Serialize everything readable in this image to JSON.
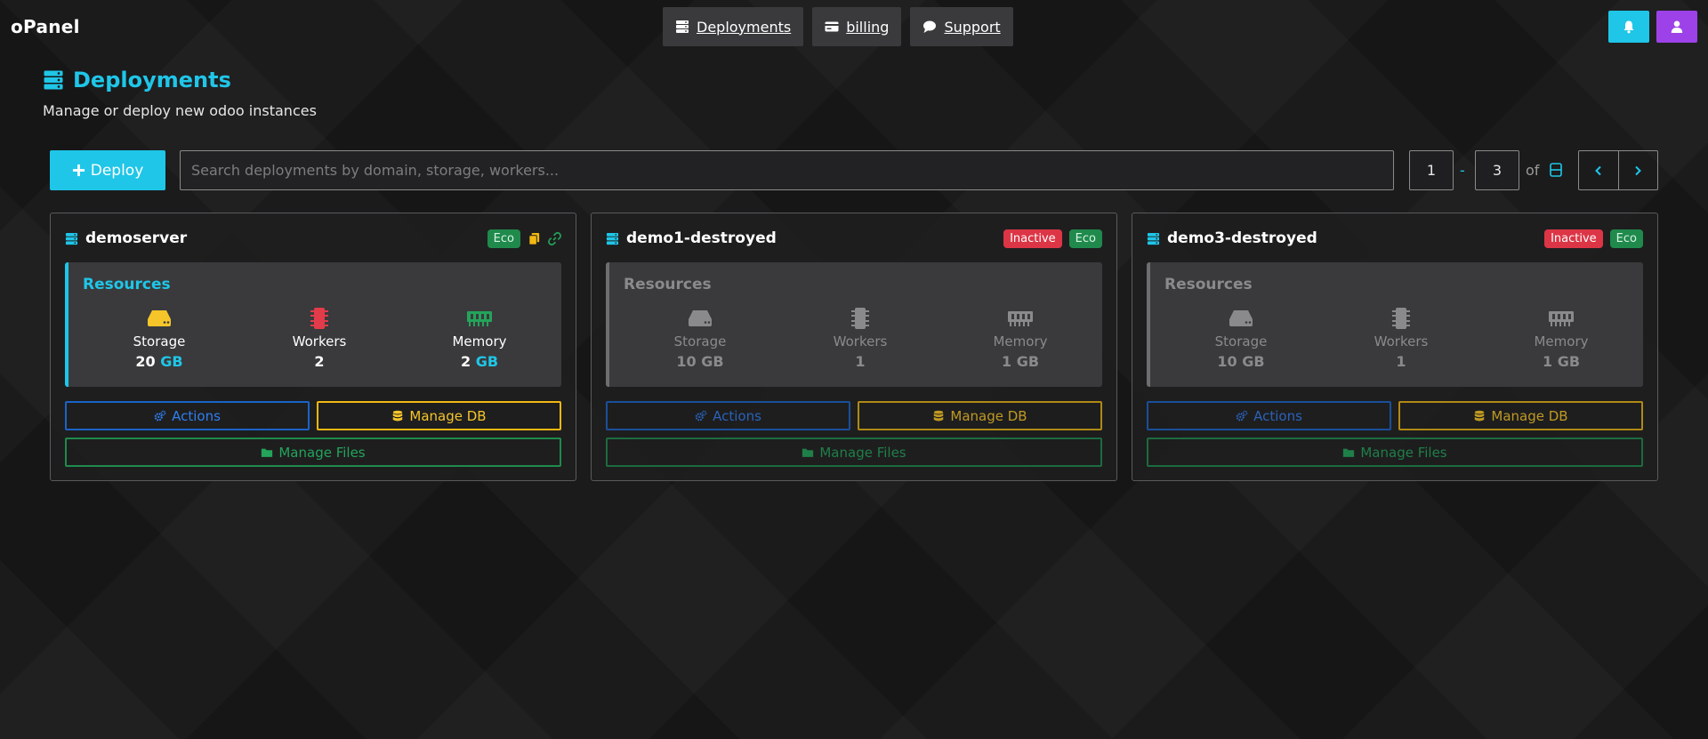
{
  "brand": "oPanel",
  "nav": {
    "deployments": "Deployments",
    "billing": "billing",
    "support": "Support"
  },
  "page": {
    "title": "Deployments",
    "subtitle": "Manage or deploy new odoo instances"
  },
  "toolbar": {
    "deploy_label": "Deploy",
    "search_placeholder": "Search deployments by domain, storage, workers...",
    "range_start": "1",
    "range_sep": "-",
    "range_end": "3",
    "of_label": "of"
  },
  "labels": {
    "resources": "Resources",
    "storage": "Storage",
    "workers": "Workers",
    "memory": "Memory",
    "actions": "Actions",
    "manage_db": "Manage DB",
    "manage_files": "Manage Files"
  },
  "deployments": [
    {
      "name": "demoserver",
      "badges": [
        "Eco"
      ],
      "storage_num": "20",
      "storage_unit": "GB",
      "workers": "2",
      "memory_num": "2",
      "memory_unit": "GB"
    },
    {
      "name": "demo1-destroyed",
      "badges": [
        "Inactive",
        "Eco"
      ],
      "storage_num": "10",
      "storage_unit": "GB",
      "workers": "1",
      "memory_num": "1",
      "memory_unit": "GB"
    },
    {
      "name": "demo3-destroyed",
      "badges": [
        "Inactive",
        "Eco"
      ],
      "storage_num": "10",
      "storage_unit": "GB",
      "workers": "1",
      "memory_num": "1",
      "memory_unit": "GB"
    }
  ],
  "colors": {
    "accent": "#1fc6e8",
    "purple": "#9d42e8",
    "danger": "#dc3545",
    "success": "#1f8a4c",
    "warning": "#f2b811",
    "primary": "#1a63c8"
  },
  "icons": {
    "nav_deployments": "server-icon",
    "nav_billing": "credit-card-icon",
    "nav_support": "comment-icon",
    "notifications": "bell-icon",
    "account": "user-icon",
    "storage": "hdd-icon",
    "workers": "cpu-chip-icon",
    "memory": "memory-icon"
  }
}
